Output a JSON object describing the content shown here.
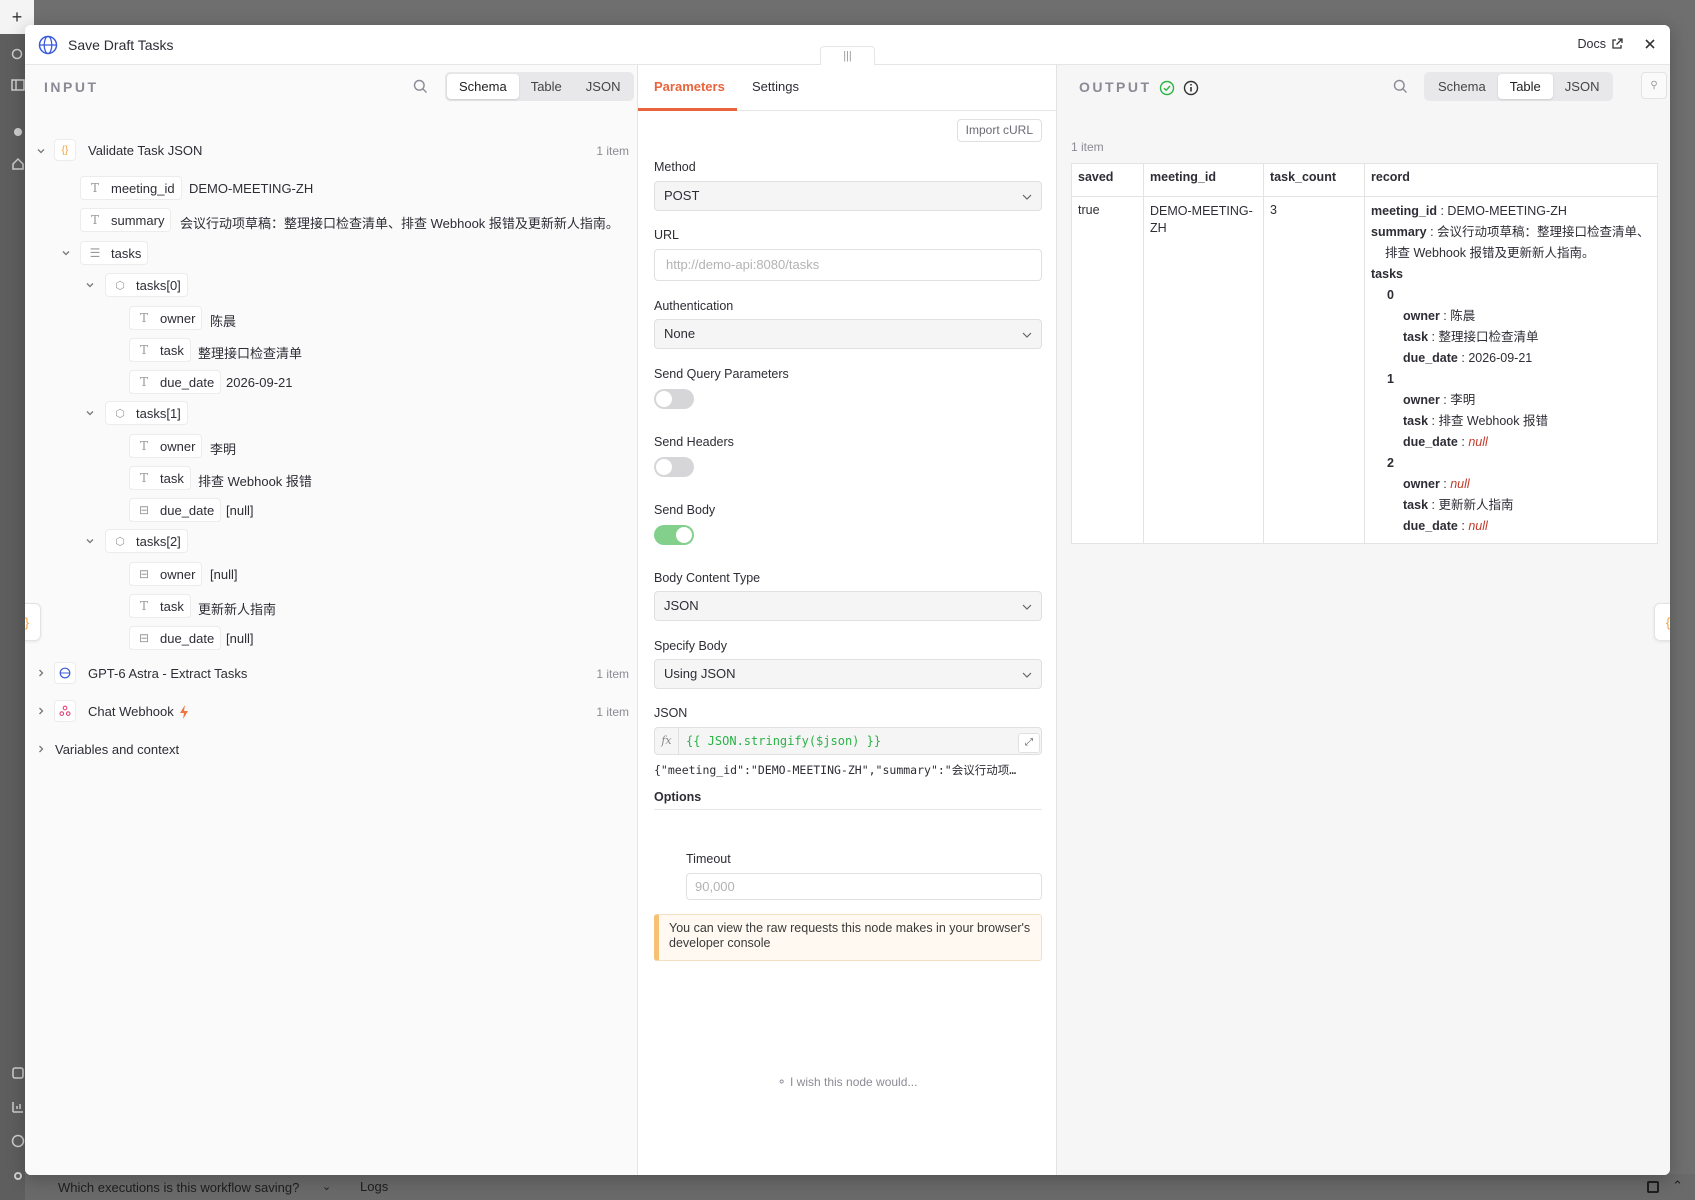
{
  "backdrop": {
    "add_icon": "plus-icon",
    "bottom_question": "Which executions is this workflow saving?",
    "logs_label": "Logs"
  },
  "modal": {
    "title": "Save Draft Tasks",
    "title_icon": "globe-icon",
    "docs_label": "Docs",
    "drag_handle": "|||"
  },
  "input": {
    "label": "INPUT",
    "view_tabs": [
      "Schema",
      "Table",
      "JSON"
    ],
    "active_view": "Schema",
    "nodes": [
      {
        "name": "Validate Task JSON",
        "count": "1 item"
      },
      {
        "name": "GPT-6 Astra - Extract Tasks",
        "count": "1 item"
      },
      {
        "name": "Chat Webhook",
        "count": "1 item"
      }
    ],
    "variables_label": "Variables and context",
    "fields": {
      "meeting_id": {
        "key": "meeting_id",
        "value": "DEMO-MEETING-ZH"
      },
      "summary": {
        "key": "summary",
        "value": "会议行动项草稿：整理接口检查清单、排查 Webhook 报错及更新新人指南。"
      },
      "tasks": {
        "key": "tasks"
      },
      "task0": {
        "label": "tasks[0]",
        "owner": "陈晨",
        "task": "整理接口检查清单",
        "due_date": "2026-09-21"
      },
      "task1": {
        "label": "tasks[1]",
        "owner": "李明",
        "task": "排查 Webhook 报错",
        "due_date": "[null]"
      },
      "task2": {
        "label": "tasks[2]",
        "owner": "[null]",
        "task": "更新新人指南",
        "due_date": "[null]"
      }
    },
    "keys": {
      "owner": "owner",
      "task": "task",
      "due_date": "due_date"
    }
  },
  "params": {
    "tabs": [
      "Parameters",
      "Settings"
    ],
    "active_tab": "Parameters",
    "import_curl": "Import cURL",
    "method_label": "Method",
    "method_value": "POST",
    "url_label": "URL",
    "url_placeholder": "http://demo-api:8080/tasks",
    "auth_label": "Authentication",
    "auth_value": "None",
    "send_query_label": "Send Query Parameters",
    "send_query_on": false,
    "send_headers_label": "Send Headers",
    "send_headers_on": false,
    "send_body_label": "Send Body",
    "send_body_on": true,
    "body_type_label": "Body Content Type",
    "body_type_value": "JSON",
    "specify_body_label": "Specify Body",
    "specify_body_value": "Using JSON",
    "json_label": "JSON",
    "json_fx": "fx",
    "json_expression": "{{ JSON.stringify($json) }}",
    "json_preview": "{\"meeting_id\":\"DEMO-MEETING-ZH\",\"summary\":\"会议行动项…",
    "options_label": "Options",
    "timeout_label": "Timeout",
    "timeout_placeholder": "90,000",
    "notice": "You can view the raw requests this node makes in your browser's developer console",
    "wish": "I wish this node would..."
  },
  "output": {
    "label": "OUTPUT",
    "status": "success",
    "view_tabs": [
      "Schema",
      "Table",
      "JSON"
    ],
    "active_view": "Table",
    "item_count": "1 item",
    "columns": [
      "saved",
      "meeting_id",
      "task_count",
      "record"
    ],
    "row": {
      "saved": "true",
      "meeting_id": "DEMO-MEETING-ZH",
      "task_count": "3",
      "record": {
        "meeting_id": "DEMO-MEETING-ZH",
        "summary_line1": "会议行动项草稿：整理接口检查清单、",
        "summary_line2": "排查 Webhook 报错及更新新人指南。",
        "tasks_key": "tasks",
        "items": [
          {
            "index": "0",
            "owner": "陈晨",
            "task": "整理接口检查清单",
            "due_date": "2026-09-21"
          },
          {
            "index": "1",
            "owner": "李明",
            "task": "排查 Webhook 报错",
            "due_date": "null"
          },
          {
            "index": "2",
            "owner": "null",
            "task": "更新新人指南",
            "due_date": "null"
          }
        ]
      }
    },
    "null_color": "#c23b2b"
  },
  "colors": {
    "accent": "#e8643c",
    "toggle_on": "#82d08c",
    "expression_green": "#2bb345",
    "brace_orange": "#f0a03c"
  }
}
